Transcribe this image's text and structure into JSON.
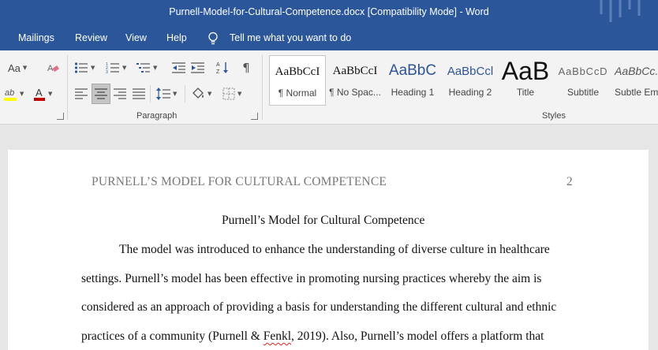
{
  "window": {
    "title": "Purnell-Model-for-Cultural-Competence.docx [Compatibility Mode]  -  Word"
  },
  "menu": {
    "items": [
      "Mailings",
      "Review",
      "View",
      "Help"
    ],
    "tell_me": "Tell me what you want to do"
  },
  "ribbon": {
    "font_size_label": "Aa",
    "paragraph_group_label": "Paragraph",
    "styles_group_label": "Styles",
    "styles": [
      {
        "preview": "AaBbCcI",
        "label": "¶ Normal",
        "selected": true
      },
      {
        "preview": "AaBbCcI",
        "label": "¶ No Spac..."
      },
      {
        "preview": "AaBbC",
        "label": "Heading 1"
      },
      {
        "preview": "AaBbCcl",
        "label": "Heading 2"
      },
      {
        "preview": "AaB",
        "label": "Title"
      },
      {
        "preview": "AaBbCcD",
        "label": "Subtitle"
      },
      {
        "preview": "AaBbCc.",
        "label": "Subtle Em..."
      }
    ],
    "colors": {
      "highlight": "#ffff00",
      "font_color": "#c00000"
    }
  },
  "document": {
    "running_head": "PURNELL’S MODEL FOR CULTURAL COMPETENCE",
    "page_number": "2",
    "heading": "Purnell’s Model for Cultural Competence",
    "lines": [
      "The model was introduced to enhance the understanding of diverse culture in healthcare",
      "settings. Purnell’s model has been effective in promoting nursing practices whereby the aim is",
      "considered as an approach of providing a basis for understanding the different cultural and ethnic"
    ],
    "line4_pre": "practices of a community (Purnell & ",
    "line4_squiggle": "Fenkl",
    "line4_post": ", 2019). Also, Purnell’s model offers a platform that"
  }
}
